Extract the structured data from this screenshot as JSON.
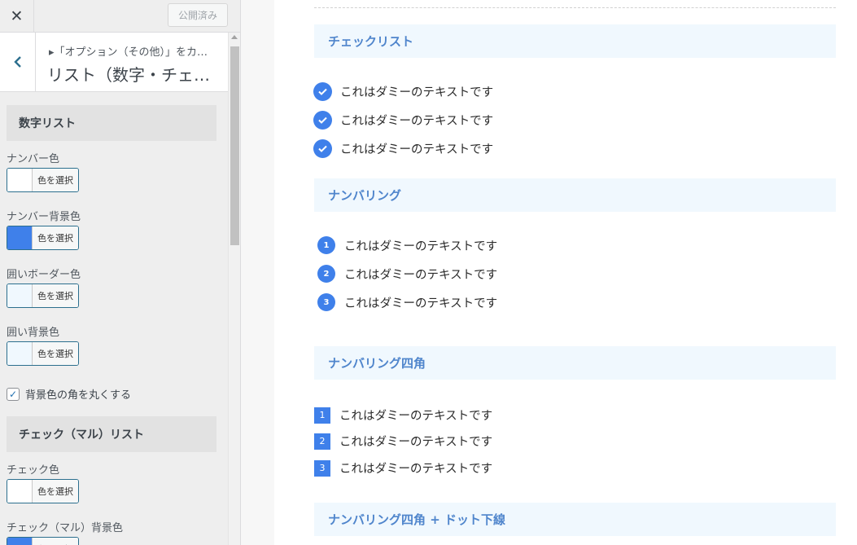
{
  "topbar": {
    "close_symbol": "✕",
    "publish_label": "公開済み"
  },
  "section_header": {
    "breadcrumb": "▸「オプション（その他）」をカ…",
    "title": "リスト（数字・チェ…"
  },
  "controls": {
    "number_list_group": "数字リスト",
    "number_color": {
      "label": "ナンバー色",
      "button": "色を選択",
      "swatch": "#ffffff"
    },
    "number_bg_color": {
      "label": "ナンバー背景色",
      "button": "色を選択",
      "swatch": "#3f80ea"
    },
    "border_color": {
      "label": "囲いボーダー色",
      "button": "色を選択",
      "swatch": "#f0f8fe"
    },
    "enclosure_bg_color": {
      "label": "囲い背景色",
      "button": "色を選択",
      "swatch": "#f0f8fe"
    },
    "rounded_checkbox": {
      "label": "背景色の角を丸くする",
      "checked": true,
      "mark": "✓"
    },
    "check_list_group": "チェック（マル）リスト",
    "check_color": {
      "label": "チェック色",
      "button": "色を選択",
      "swatch": "#ffffff"
    },
    "check_bg_color": {
      "label": "チェック（マル）背景色",
      "button": "色を選択",
      "swatch": "#3f80ea"
    }
  },
  "preview": {
    "sections": [
      {
        "heading": "チェックリスト",
        "style": "check",
        "items": [
          "これはダミーのテキストです",
          "これはダミーのテキストです",
          "これはダミーのテキストです"
        ]
      },
      {
        "heading": "ナンバリング",
        "style": "number-circle",
        "items": [
          "これはダミーのテキストです",
          "これはダミーのテキストです",
          "これはダミーのテキストです"
        ],
        "numbers": [
          "1",
          "2",
          "3"
        ]
      },
      {
        "heading": "ナンバリング四角",
        "style": "number-square",
        "items": [
          "これはダミーのテキストです",
          "これはダミーのテキストです",
          "これはダミーのテキストです"
        ],
        "numbers": [
          "1",
          "2",
          "3"
        ]
      },
      {
        "heading": "ナンバリング四角 + ドット下線",
        "style": "number-square-dotted"
      }
    ]
  },
  "colors": {
    "accent": "#3f80ea",
    "heading_bg": "#f0f8fe",
    "heading_text": "#4f85cc"
  }
}
